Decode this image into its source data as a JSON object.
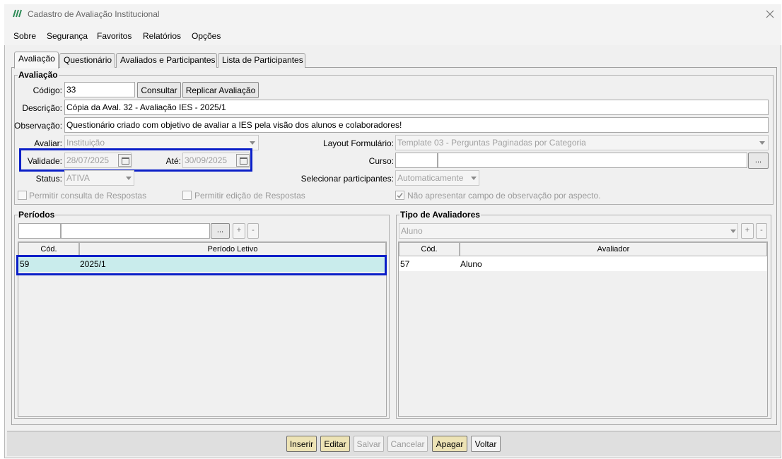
{
  "window": {
    "title": "Cadastro de Avaliação Institucional"
  },
  "menu": [
    "Sobre",
    "Segurança",
    "Favoritos",
    "Relatórios",
    "Opções"
  ],
  "tabs": [
    "Avaliação",
    "Questionário",
    "Avaliados e Participantes",
    "Lista de Participantes"
  ],
  "avaliacao": {
    "group_title": "Avaliação",
    "codigo_label": "Código:",
    "codigo_value": "33",
    "consultar_button": "Consultar",
    "replicar_button": "Replicar Avaliação",
    "descricao_label": "Descrição:",
    "descricao_value": "Cópia da Aval. 32 - Avaliação IES - 2025/1",
    "observacao_label": "Observação:",
    "observacao_value": "Questionário criado com objetivo de avaliar a IES pela visão dos alunos e colaboradores!",
    "avaliar_label": "Avaliar:",
    "avaliar_value": "Instituição",
    "layout_label": "Layout Formulário:",
    "layout_value": "Template 03 - Perguntas Paginadas por Categoria",
    "validade_label": "Validade:",
    "validade_value": "28/07/2025",
    "ate_label": "Até:",
    "ate_value": "30/09/2025",
    "curso_label": "Curso:",
    "curso_button": "...",
    "status_label": "Status:",
    "status_value": "ATIVA",
    "selecionar_label": "Selecionar participantes:",
    "selecionar_value": "Automaticamente",
    "chk_consulta": "Permitir consulta de Respostas",
    "chk_edicao": "Permitir edição de Respostas",
    "chk_observacao": "Não apresentar campo de observação por aspecto."
  },
  "periodos": {
    "group_title": "Períodos",
    "dots_button": "...",
    "add_button": "+",
    "remove_button": "-",
    "columns": [
      "Cód.",
      "Período Letivo"
    ],
    "rows": [
      {
        "cod": "59",
        "periodo": "2025/1"
      }
    ]
  },
  "avaliadores": {
    "group_title": "Tipo de Avaliadores",
    "select_value": "Aluno",
    "add_button": "+",
    "remove_button": "-",
    "columns": [
      "Cód.",
      "Avaliador"
    ],
    "rows": [
      {
        "cod": "57",
        "avaliador": "Aluno"
      }
    ]
  },
  "footer": {
    "inserir": "Inserir",
    "editar": "Editar",
    "salvar": "Salvar",
    "cancelar": "Cancelar",
    "apagar": "Apagar",
    "voltar": "Voltar"
  },
  "colors": {
    "highlight": "#0b1fc8",
    "selected_row": "#c9ecec",
    "action_button": "#ede3b5"
  }
}
